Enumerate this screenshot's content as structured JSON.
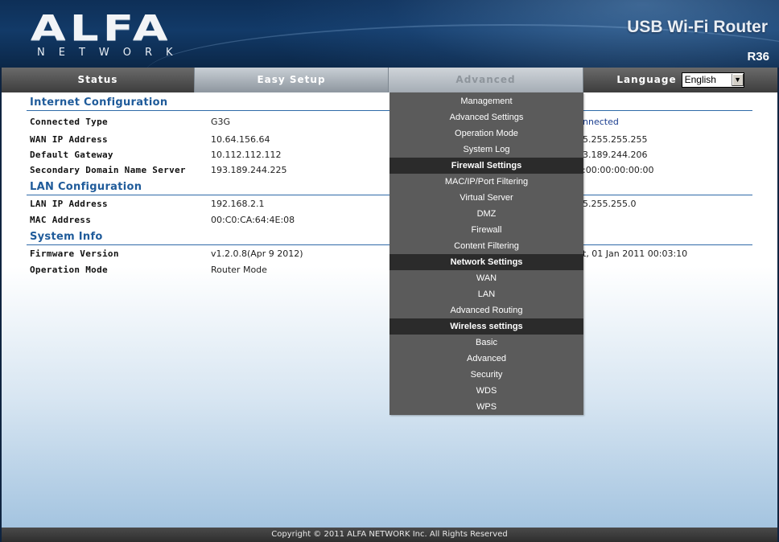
{
  "header": {
    "brand_main": "ALFA",
    "brand_sub": "NETWORK",
    "product_title": "USB Wi-Fi Router",
    "model": "R36"
  },
  "nav": {
    "status": "Status",
    "easy_setup": "Easy Setup",
    "advanced": "Advanced",
    "language_label": "Language",
    "language_value": "English"
  },
  "sections": {
    "internet": {
      "title": "Internet Configuration",
      "rows": [
        {
          "label": "Connected Type",
          "value": "G3G"
        },
        {
          "label": "WAN IP Address",
          "value": "10.64.156.64"
        },
        {
          "label": "Default Gateway",
          "value": "10.112.112.112"
        },
        {
          "label": "Secondary Domain Name Server",
          "value": "193.189.244.225"
        }
      ],
      "right_values": [
        "nnected",
        "5.255.255.255",
        "3.189.244.206",
        ":00:00:00:00:00"
      ]
    },
    "lan": {
      "title": "LAN Configuration",
      "rows": [
        {
          "label": "LAN IP Address",
          "value": "192.168.2.1"
        },
        {
          "label": "MAC Address",
          "value": "00:C0:CA:64:4E:08"
        }
      ],
      "right_values": [
        "5.255.255.0"
      ]
    },
    "system": {
      "title": "System Info",
      "rows": [
        {
          "label": "Firmware Version",
          "value": "v1.2.0.8(Apr 9 2012)"
        },
        {
          "label": "Operation Mode",
          "value": "Router Mode"
        }
      ],
      "right_values": [
        "t, 01 Jan 2011 00:03:10"
      ]
    }
  },
  "dropdown": {
    "items": [
      {
        "type": "item",
        "label": "Management"
      },
      {
        "type": "item",
        "label": "Advanced Settings"
      },
      {
        "type": "item",
        "label": "Operation Mode"
      },
      {
        "type": "item",
        "label": "System Log"
      },
      {
        "type": "header",
        "label": "Firewall Settings"
      },
      {
        "type": "item",
        "label": "MAC/IP/Port Filtering"
      },
      {
        "type": "item",
        "label": "Virtual Server"
      },
      {
        "type": "item",
        "label": "DMZ"
      },
      {
        "type": "item",
        "label": "Firewall"
      },
      {
        "type": "item",
        "label": "Content Filtering"
      },
      {
        "type": "header",
        "label": "Network Settings"
      },
      {
        "type": "item",
        "label": "WAN"
      },
      {
        "type": "item",
        "label": "LAN"
      },
      {
        "type": "item",
        "label": "Advanced Routing"
      },
      {
        "type": "header",
        "label": "Wireless settings"
      },
      {
        "type": "item",
        "label": "Basic"
      },
      {
        "type": "item",
        "label": "Advanced"
      },
      {
        "type": "item",
        "label": "Security"
      },
      {
        "type": "item",
        "label": "WDS"
      },
      {
        "type": "item",
        "label": "WPS"
      }
    ]
  },
  "footer": {
    "copyright": "Copyright © 2011 ALFA NETWORK Inc. All Rights Reserved"
  },
  "colors": {
    "header_bg": "#123a68",
    "section_title": "#1f5b9a",
    "dropdown_bg": "#5b5b5b",
    "dropdown_header_bg": "#2b2b2b"
  }
}
